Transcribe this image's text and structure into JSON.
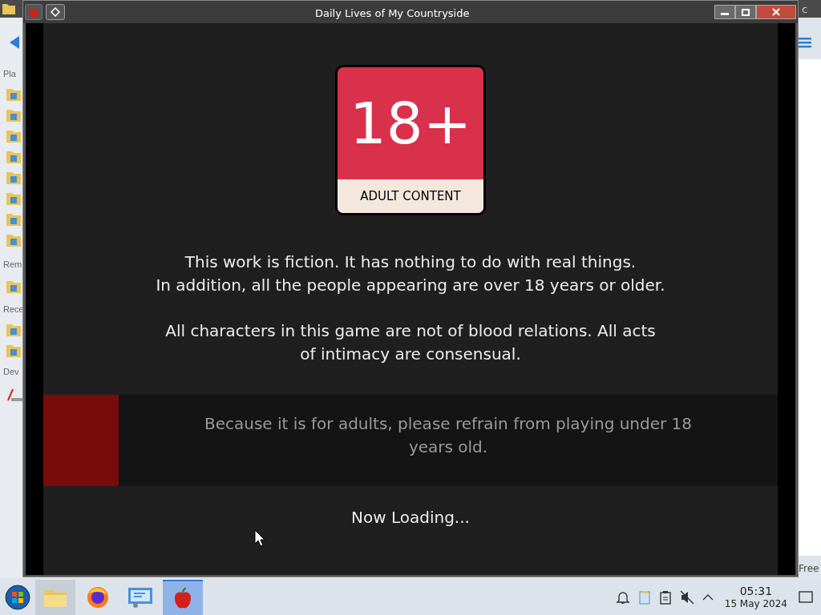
{
  "window": {
    "title": "Daily Lives of My Countryside"
  },
  "background_window": {
    "sidebar_sections": [
      "Pla",
      "Rem",
      "Rece",
      "Dev"
    ],
    "top_edge_text": "c",
    "right_edge_text": "Free"
  },
  "game": {
    "badge": {
      "number": "18+",
      "caption": "ADULT CONTENT"
    },
    "notices": [
      [
        "This work is fiction. It has nothing to do with real things.",
        "In addition, all the people appearing are over 18 years or older."
      ],
      [
        "All characters in this game are not of blood relations. All acts",
        "of intimacy are consensual."
      ]
    ],
    "warning": [
      "Because it is for adults, please refrain from playing under 18",
      "years old."
    ],
    "loading": "Now Loading..."
  },
  "taskbar": {
    "apps": [
      {
        "kind": "folder",
        "selected": false,
        "hovered": true
      },
      {
        "kind": "browser",
        "selected": false,
        "hovered": false
      },
      {
        "kind": "settings",
        "selected": false,
        "hovered": false
      },
      {
        "kind": "apple",
        "selected": true,
        "hovered": false
      }
    ],
    "clock": {
      "time": "05:31",
      "date": "15 May 2024"
    }
  }
}
